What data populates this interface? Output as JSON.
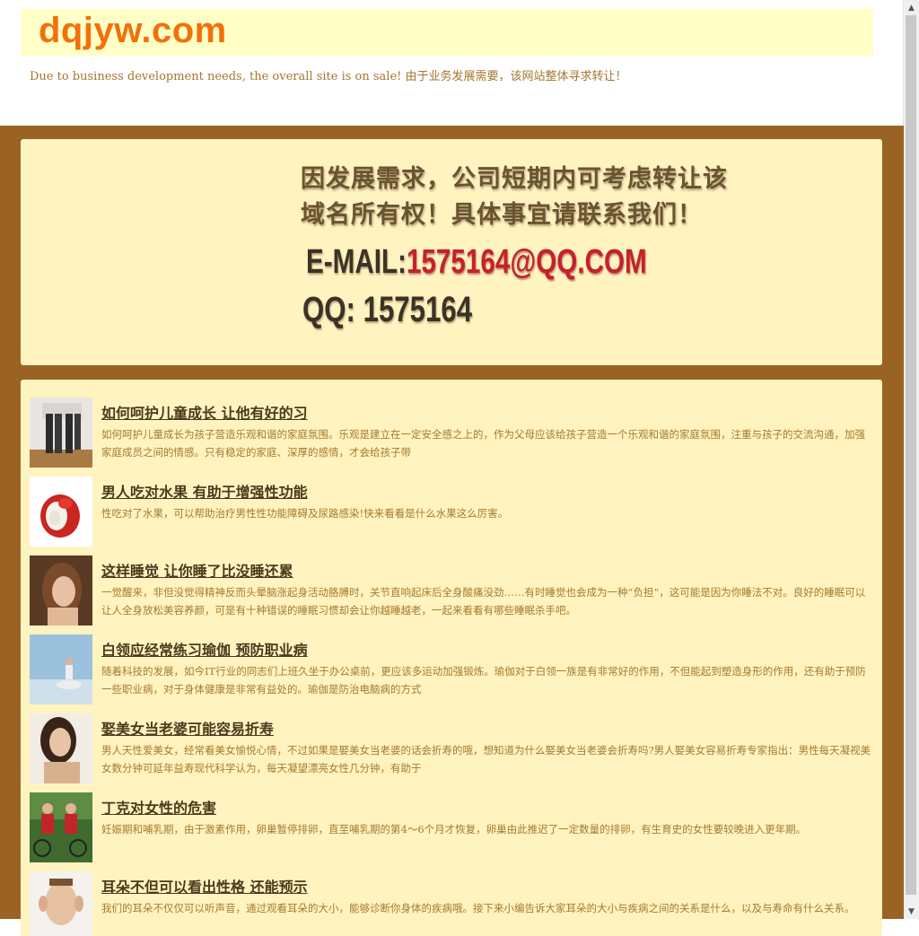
{
  "site": {
    "logo": "dqjyw.com",
    "sale_notice": "Due to business development needs, the overall site is on sale! 由于业务发展需要，该网站整体寻求转让！"
  },
  "contact": {
    "line1": "因发展需求，公司短期内可考虑转让该",
    "line2": "域名所有权！具体事宜请联系我们！",
    "email_label": "E-MAIL:",
    "email_value": "1575164@QQ.COM",
    "qq": "QQ: 1575164"
  },
  "articles": [
    {
      "title": "如何呵护儿童成长 让他有好的习",
      "desc": "如何呵护儿童成长为孩子营造乐观和谐的家庭氛围。乐观是建立在一定安全感之上的，作为父母应该给孩子营造一个乐观和谐的家庭氛围，注重与孩子的交流沟通，加强家庭成员之间的情感。只有稳定的家庭、深厚的感情，才会给孩子带",
      "thumb_icon": "legs-photo-icon"
    },
    {
      "title": "男人吃对水果 有助于增强性功能",
      "desc": "性吃对了水果，可以帮助治疗男性性功能障碍及尿路感染!快来看看是什么水果这么厉害。",
      "thumb_icon": "lychee-photo-icon"
    },
    {
      "title": "这样睡觉 让你睡了比没睡还累",
      "desc": "一觉醒来，非但没觉得精神反而头晕脑涨起身活动胳膊时，关节直响起床后全身酸痛没劲……有时睡觉也会成为一种“负担”，这可能是因为你睡法不对。良好的睡眠可以让人全身放松美容养颜，可是有十种错误的睡眠习惯却会让你越睡越老，一起来看看有哪些睡眠杀手吧。",
      "thumb_icon": "sleeping-woman-photo-icon"
    },
    {
      "title": "白领应经常练习瑜伽 预防职业病",
      "desc": "随着科技的发展，如今IT行业的同志们上班久坐于办公桌前，更应该多运动加强锻炼。瑜伽对于白领一族是有非常好的作用，不但能起到塑造身形的作用，还有助于预防一些职业病，对于身体健康是非常有益处的。瑜伽是防治电脑病的方式",
      "thumb_icon": "yoga-photo-icon"
    },
    {
      "title": "娶美女当老婆可能容易折寿",
      "desc": "男人天性爱美女，经常看美女愉悦心情，不过如果是娶美女当老婆的话会折寿的哦，想知道为什么娶美女当老婆会折寿吗?男人娶美女容易折寿专家指出：男性每天凝视美女数分钟可延年益寿现代科学认为，每天凝望漂亮女性几分钟，有助于",
      "thumb_icon": "woman-portrait-photo-icon"
    },
    {
      "title": "丁克对女性的危害",
      "desc": "妊娠期和哺乳期，由于激素作用，卵巢暂停排卵，直至哺乳期的第4～6个月才恢复，卵巢由此推迟了一定数量的排卵，有生育史的女性要较晚进入更年期。",
      "thumb_icon": "cycling-couple-photo-icon"
    },
    {
      "title": "耳朵不但可以看出性格 还能预示",
      "desc": "我们的耳朵不仅仅可以听声音，通过观看耳朵的大小，能够诊断你身体的疾病哦。接下来小编告诉大家耳朵的大小与疾病之间的关系是什么，以及与寿命有什么关系。",
      "thumb_icon": "man-ears-photo-icon"
    }
  ]
}
